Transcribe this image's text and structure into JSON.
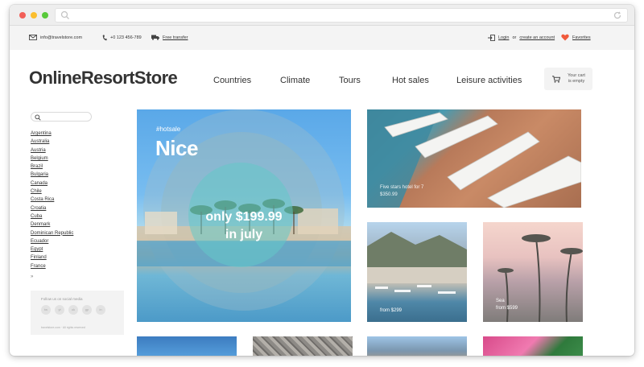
{
  "infobar": {
    "email": "info@travelstore.com",
    "phone": "+0 123 456-789",
    "free_transfer": "Free transfer",
    "login": "Login",
    "or": "or",
    "create_account": "create an account",
    "favorites": "Favorites"
  },
  "header": {
    "logo": "OnlineResortStore",
    "nav": [
      "Countries",
      "Climate",
      "Tours",
      "Hot sales",
      "Leisure activities"
    ],
    "cart_line1": "Your cart",
    "cart_line2": "is empty"
  },
  "sidebar": {
    "countries": [
      "Argentina",
      "Australia",
      "Austria",
      "Belgium",
      "Brazil",
      "Bulgaria",
      "Canada",
      "Chile",
      "Costa Rica",
      "Croatia",
      "Cuba",
      "Denmark",
      "Dominican Republic",
      "Ecuador",
      "Egypt",
      "Finland",
      "France"
    ],
    "more": "»",
    "follow_label": "Follow us on social media",
    "social": [
      "tw",
      "yt",
      "ok",
      "gp",
      "in"
    ],
    "copyright": "travelstore.com · All rights reserved"
  },
  "tiles": {
    "hero": {
      "tag": "#hotsale",
      "city": "Nice",
      "price_line1": "only $199.99",
      "price_line2": "in july"
    },
    "pool": {
      "line1": "Five stars hotel for 7",
      "line2": "$350.99"
    },
    "harbor": {
      "line1": "from $299"
    },
    "palms": {
      "line1": "Sea",
      "line2": "from $599"
    }
  },
  "colors": {
    "favorite_heart": "#f05a3c",
    "text": "#333333",
    "infobar_bg": "#f4f4f4"
  }
}
